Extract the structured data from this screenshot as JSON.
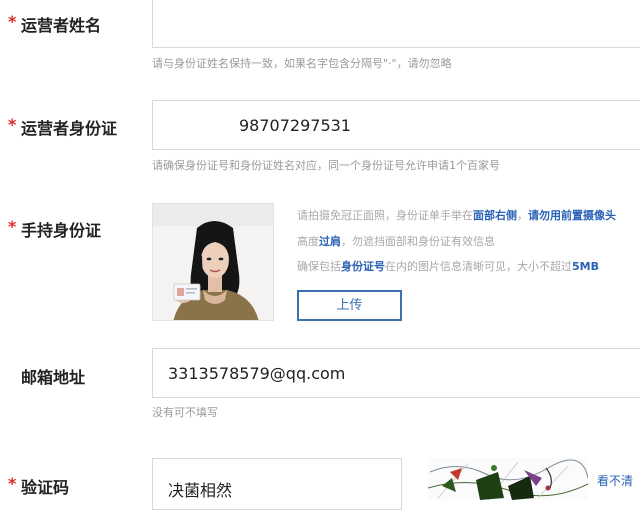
{
  "form": {
    "operator_name": {
      "required_mark": "*",
      "label": "运营者姓名",
      "value": "",
      "hint": "请与身份证姓名保持一致，如果名字包含分隔号\"·\"，请勿忽略"
    },
    "operator_id": {
      "required_mark": "*",
      "label": "运营者身份证",
      "value": "98707297531",
      "hint": "请确保身份证号和身份证姓名对应，同一个身份证号允许申请1个百家号"
    },
    "id_photo": {
      "required_mark": "*",
      "label": "手持身份证",
      "hint_line1_a": "请拍摄免冠正面照，身份证单手举在",
      "hint_line1_b": "面部右侧",
      "hint_line1_c": "，",
      "hint_line1_d": "请勿用前置摄像头",
      "hint_line2_a": "高度",
      "hint_line2_b": "过肩",
      "hint_line2_c": "，勿遮挡面部和身份证有效信息",
      "hint_line3_a": "确保包括",
      "hint_line3_b": "身份证号",
      "hint_line3_c": "在内的图片信息清晰可见，大小不超过",
      "hint_line3_d": "5MB",
      "upload_label": "上传"
    },
    "email": {
      "label": "邮箱地址",
      "value": "3313578579@qq.com",
      "hint": "没有可不填写"
    },
    "captcha": {
      "required_mark": "*",
      "label": "验证码",
      "value": "决菌相然",
      "refresh_label": "看不清"
    }
  },
  "colors": {
    "required": "#e02b2b",
    "accent": "#2a62b6",
    "border": "#d9d9d9"
  }
}
